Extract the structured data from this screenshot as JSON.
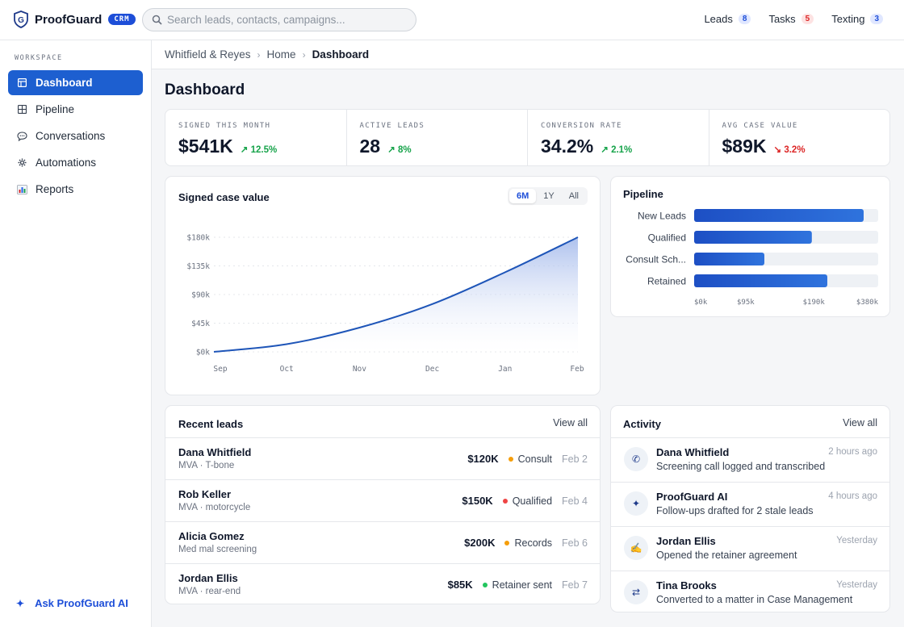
{
  "brand": {
    "name": "ProofGuard",
    "badge": "CRM",
    "logo_letter": "G"
  },
  "search": {
    "placeholder": "Search leads, contacts, campaigns..."
  },
  "top_links": [
    {
      "label": "Leads",
      "count": "8",
      "tone": "blue"
    },
    {
      "label": "Tasks",
      "count": "5",
      "tone": "red"
    },
    {
      "label": "Texting",
      "count": "3",
      "tone": "blue"
    }
  ],
  "sidebar": {
    "section_label": "WORKSPACE",
    "items": [
      {
        "label": "Dashboard",
        "icon": "dashboard-icon",
        "active": true
      },
      {
        "label": "Pipeline",
        "icon": "pipeline-icon",
        "active": false
      },
      {
        "label": "Conversations",
        "icon": "chat-icon",
        "active": false
      },
      {
        "label": "Automations",
        "icon": "gear-icon",
        "active": false
      },
      {
        "label": "Reports",
        "icon": "bar-chart-icon",
        "active": false
      }
    ],
    "ask_ai": "Ask ProofGuard AI"
  },
  "breadcrumb": [
    "Whitfield & Reyes",
    "Home",
    "Dashboard"
  ],
  "page_title": "Dashboard",
  "stats": [
    {
      "label": "SIGNED THIS MONTH",
      "value": "$541K",
      "delta": "12.5%",
      "direction": "up"
    },
    {
      "label": "ACTIVE LEADS",
      "value": "28",
      "delta": "8%",
      "direction": "up"
    },
    {
      "label": "CONVERSION RATE",
      "value": "34.2%",
      "delta": "2.1%",
      "direction": "up"
    },
    {
      "label": "AVG CASE VALUE",
      "value": "$89K",
      "delta": "3.2%",
      "direction": "down"
    }
  ],
  "colors": {
    "accent": "#1d5fd0",
    "up": "#16a34a",
    "down": "#dc2626"
  },
  "chart_card": {
    "title": "Signed case value",
    "ranges": [
      "6M",
      "1Y",
      "All"
    ],
    "active_range": "6M"
  },
  "pipeline_card": {
    "title": "Pipeline"
  },
  "chart_data": [
    {
      "type": "area",
      "title": "Signed case value",
      "x": [
        "Sep",
        "Oct",
        "Nov",
        "Dec",
        "Jan",
        "Feb"
      ],
      "values": [
        0,
        12000,
        38000,
        75000,
        125000,
        180000
      ],
      "y_ticks": [
        "$0k",
        "$45k",
        "$90k",
        "$135k",
        "$180k"
      ],
      "ylim": [
        0,
        180000
      ],
      "grid": true,
      "color": "#1e55b8"
    },
    {
      "type": "bar",
      "orientation": "horizontal",
      "title": "Pipeline",
      "categories": [
        "New Leads",
        "Qualified",
        "Consult Sch...",
        "Retained"
      ],
      "values": [
        350000,
        243000,
        145000,
        275000
      ],
      "x_ticks": [
        "$0k",
        "$95k",
        "$190k",
        "$380k"
      ],
      "xlim": [
        0,
        380000
      ],
      "color": "#1d5fd0"
    }
  ],
  "recent_leads": {
    "title": "Recent leads",
    "view_all": "View all",
    "rows": [
      {
        "name": "Dana Whitfield",
        "sub": "MVA · T-bone",
        "amount": "$120K",
        "stage": "Consult",
        "stage_color": "#f59e0b",
        "date": "Feb 2"
      },
      {
        "name": "Rob Keller",
        "sub": "MVA · motorcycle",
        "amount": "$150K",
        "stage": "Qualified",
        "stage_color": "#ef4444",
        "date": "Feb 4"
      },
      {
        "name": "Alicia Gomez",
        "sub": "Med mal screening",
        "amount": "$200K",
        "stage": "Records",
        "stage_color": "#f59e0b",
        "date": "Feb 6"
      },
      {
        "name": "Jordan Ellis",
        "sub": "MVA · rear-end",
        "amount": "$85K",
        "stage": "Retainer sent",
        "stage_color": "#22c55e",
        "date": "Feb 7"
      }
    ]
  },
  "activity": {
    "title": "Activity",
    "view_all": "View all",
    "rows": [
      {
        "name": "Dana Whitfield",
        "desc": "Screening call logged and transcribed",
        "time": "2 hours ago",
        "icon": "phone-icon",
        "glyph": "✆"
      },
      {
        "name": "ProofGuard AI",
        "desc": "Follow-ups drafted for 2 stale leads",
        "time": "4 hours ago",
        "icon": "sparkle-icon",
        "glyph": "✦"
      },
      {
        "name": "Jordan Ellis",
        "desc": "Opened the retainer agreement",
        "time": "Yesterday",
        "icon": "signature-icon",
        "glyph": "✍"
      },
      {
        "name": "Tina Brooks",
        "desc": "Converted to a matter in Case Management",
        "time": "Yesterday",
        "icon": "swap-icon",
        "glyph": "⇄"
      }
    ]
  }
}
